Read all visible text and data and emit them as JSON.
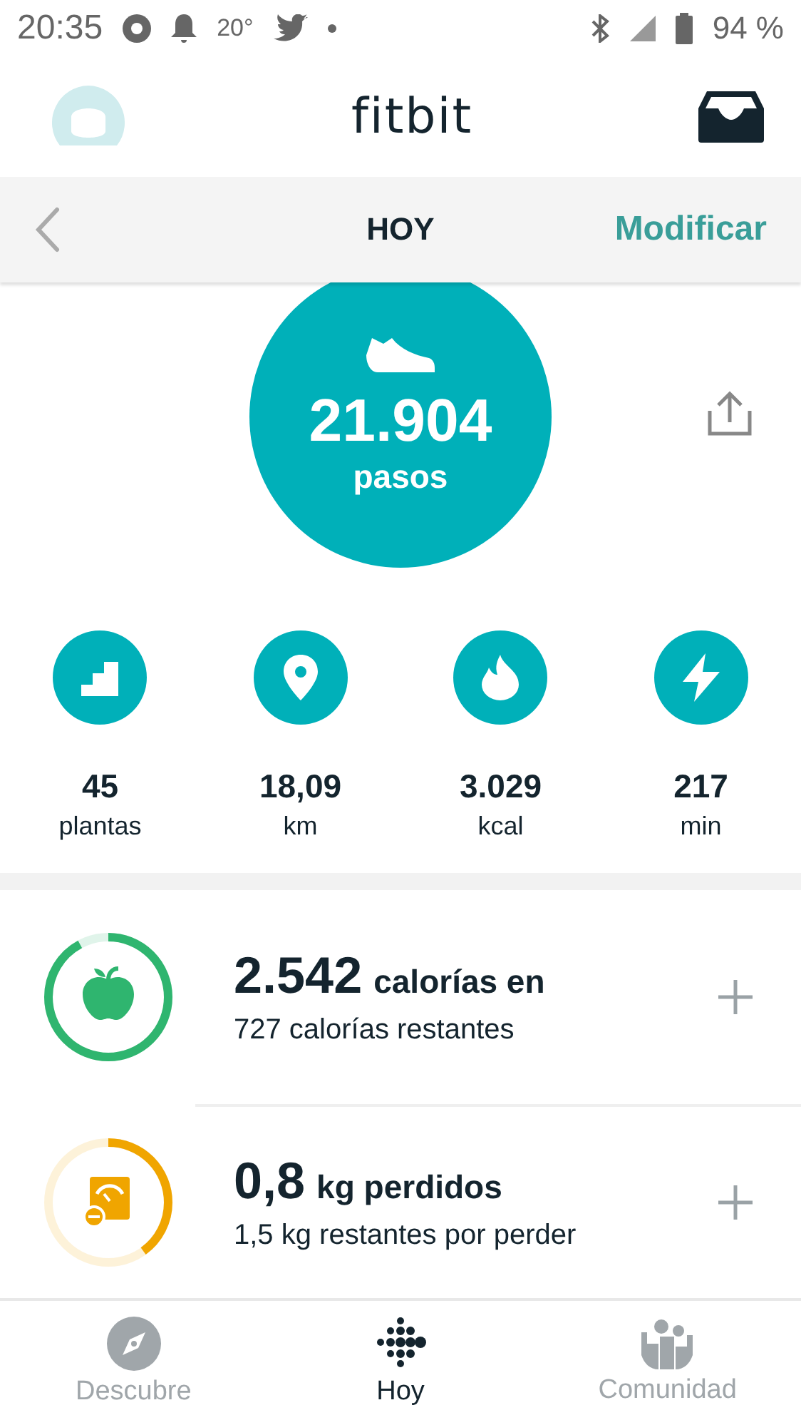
{
  "status_bar": {
    "time": "20:35",
    "temperature": "20°",
    "battery": "94 %"
  },
  "header": {
    "logo": "fitbit"
  },
  "subheader": {
    "title": "HOY",
    "action": "Modificar"
  },
  "steps": {
    "value": "21.904",
    "unit": "pasos"
  },
  "stats": [
    {
      "kind": "stairs",
      "value": "45",
      "label": "plantas"
    },
    {
      "kind": "location",
      "value": "18,09",
      "label": "km"
    },
    {
      "kind": "flame",
      "value": "3.029",
      "label": "kcal"
    },
    {
      "kind": "bolt",
      "value": "217",
      "label": "min"
    }
  ],
  "goals": [
    {
      "kind": "food",
      "value": "2.542",
      "unit": "calorías en",
      "detail": "727 calorías restantes",
      "level": 0.92,
      "color": "#2fb56f"
    },
    {
      "kind": "weight",
      "value": "0,8",
      "unit": "kg perdidos",
      "detail": "1,5 kg restantes por perder",
      "level": 0.4,
      "color": "#f0a500"
    }
  ],
  "nav": [
    {
      "kind": "compass",
      "label": "Descubre",
      "selected": false
    },
    {
      "kind": "dots",
      "label": "Hoy",
      "selected": true
    },
    {
      "kind": "people",
      "label": "Comunidad",
      "selected": false
    }
  ]
}
